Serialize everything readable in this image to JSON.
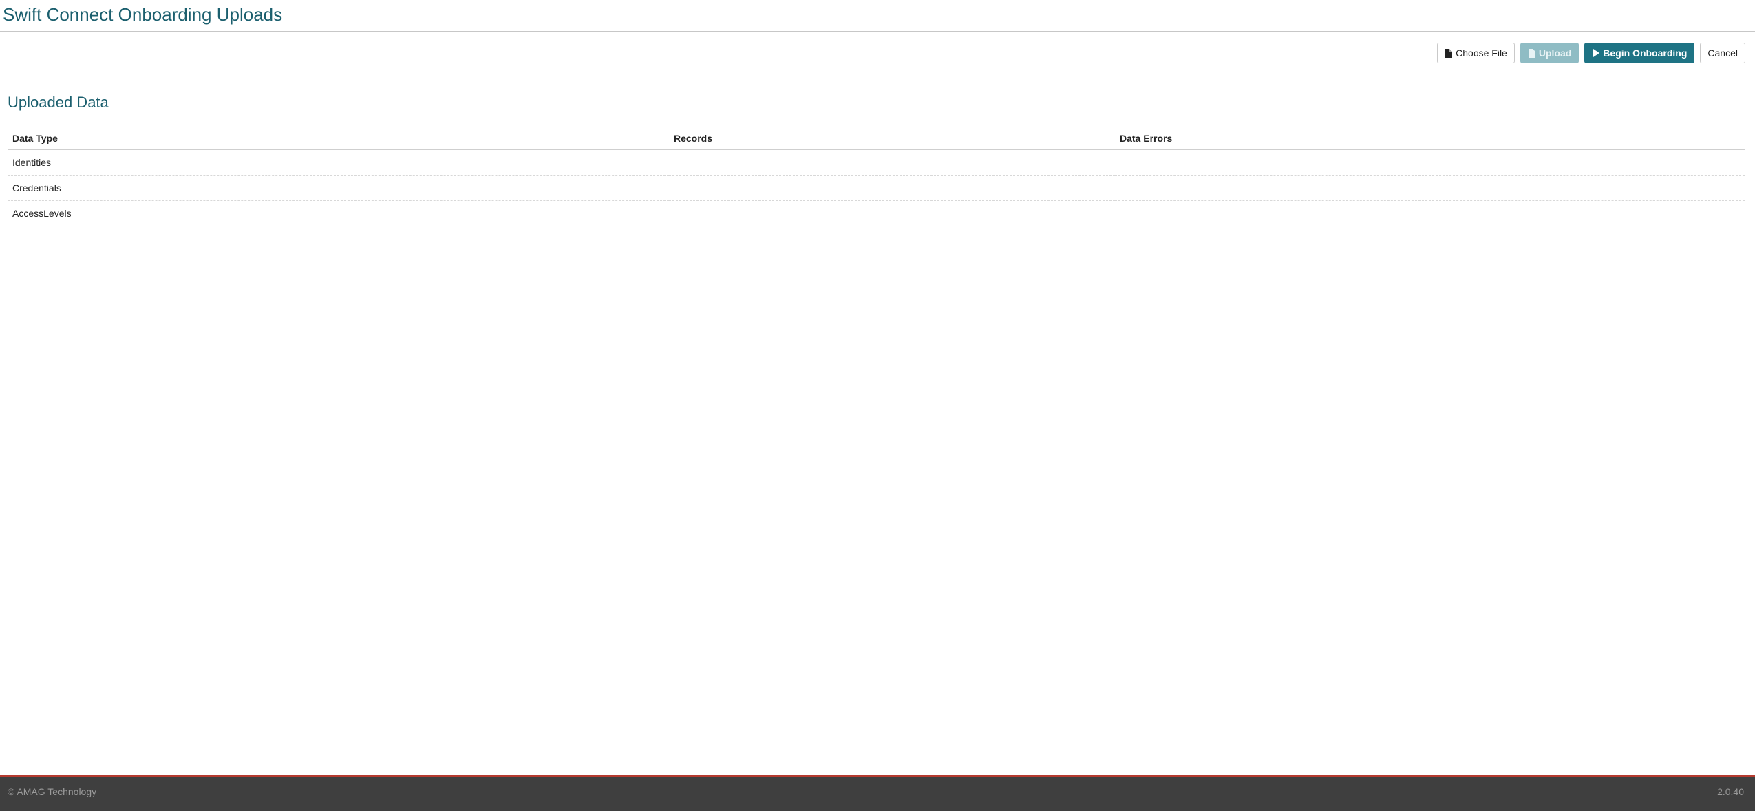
{
  "header": {
    "title": "Swift Connect Onboarding Uploads"
  },
  "toolbar": {
    "choose_file_label": "Choose File",
    "choose_file_icon": "file-icon",
    "upload_label": "Upload",
    "upload_icon": "file-icon",
    "upload_disabled": true,
    "begin_onboarding_label": "Begin Onboarding",
    "begin_onboarding_icon": "play-icon",
    "cancel_label": "Cancel"
  },
  "main": {
    "section_title": "Uploaded Data",
    "table": {
      "columns": [
        "Data Type",
        "Records",
        "Data Errors"
      ],
      "rows": [
        {
          "data_type": "Identities",
          "records": "",
          "data_errors": ""
        },
        {
          "data_type": "Credentials",
          "records": "",
          "data_errors": ""
        },
        {
          "data_type": "AccessLevels",
          "records": "",
          "data_errors": ""
        }
      ]
    }
  },
  "footer": {
    "copyright": "© AMAG Technology",
    "version": "2.0.40"
  },
  "colors": {
    "accent": "#1b5f6e",
    "primary_button": "#1e7384",
    "disabled_button": "#8fbcc4",
    "footer_bg": "#3f3f3f",
    "footer_border": "#b53a2f"
  }
}
